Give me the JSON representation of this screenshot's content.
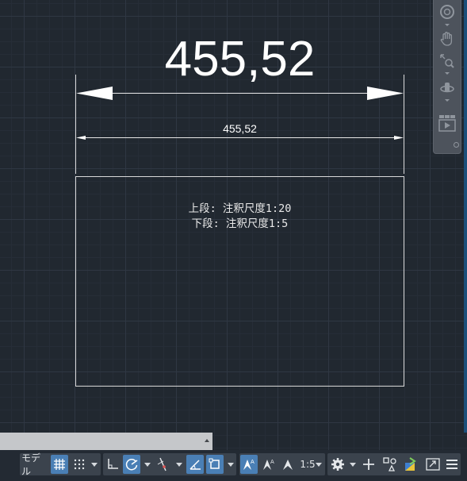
{
  "drawing": {
    "dimension_large": "455,52",
    "dimension_small": "455,52",
    "note_line1": "上段: 注釈尺度1:20",
    "note_line2": "下段: 注釈尺度1:5"
  },
  "statusbar": {
    "model_label": "モデル",
    "annotation_scale": "1:5"
  },
  "navbar": {
    "tools": [
      "steering-wheel-icon",
      "pan-hand-icon",
      "zoom-icon",
      "orbit-icon",
      "showmotion-icon"
    ]
  },
  "colors": {
    "background": "#212830",
    "active": "#4a7fb5",
    "cmdline": "#c5c7ca"
  }
}
